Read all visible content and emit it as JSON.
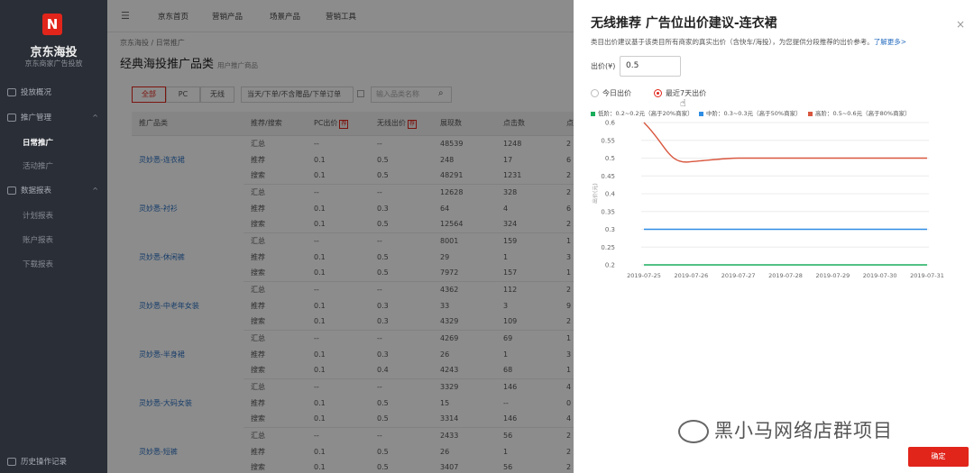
{
  "sidebar": {
    "logo_glyph": "N",
    "brand": "京东海投",
    "brand_sub": "京东商家广告投放",
    "items": [
      {
        "label": "投放概况",
        "type": "main",
        "icon": "monitor-icon"
      },
      {
        "label": "推广管理",
        "type": "main",
        "icon": "folder-icon",
        "chevron": "^"
      },
      {
        "label": "日常推广",
        "type": "sub",
        "active": true
      },
      {
        "label": "活动推广",
        "type": "sub"
      },
      {
        "label": "数据报表",
        "type": "main",
        "icon": "chart-icon",
        "chevron": "^"
      },
      {
        "label": "计划报表",
        "type": "sub"
      },
      {
        "label": "账户报表",
        "type": "sub"
      },
      {
        "label": "下载报表",
        "type": "sub"
      }
    ],
    "footer": "历史操作记录"
  },
  "topbar": {
    "menu_icon": "☰",
    "items": [
      "京东首页",
      "营销产品",
      "场景产品",
      "营销工具"
    ]
  },
  "main": {
    "breadcrumb": "京东海投 / 日常推广",
    "title": "经典海投推广品类",
    "title_sub": "用户推广商品",
    "tabs": [
      "全部",
      "PC",
      "无线"
    ],
    "filter_select": "当天/下单/不含赠品/下单订单",
    "search_placeholder": "输入品类名称",
    "columns": [
      "推广品类",
      "推荐/搜索",
      "PC出价",
      "无线出价",
      "展现数",
      "点击数",
      "点"
    ],
    "tag": "荐",
    "rows": [
      {
        "product": "灵妙悉-连衣裙",
        "lines": [
          [
            "汇总",
            "--",
            "--",
            "48539",
            "1248",
            "2"
          ],
          [
            "推荐",
            "0.1",
            "0.5",
            "248",
            "17",
            "6"
          ],
          [
            "搜索",
            "0.1",
            "0.5",
            "48291",
            "1231",
            "2"
          ]
        ]
      },
      {
        "product": "灵妙悉-衬衫",
        "lines": [
          [
            "汇总",
            "--",
            "--",
            "12628",
            "328",
            "2"
          ],
          [
            "推荐",
            "0.1",
            "0.3",
            "64",
            "4",
            "6"
          ],
          [
            "搜索",
            "0.1",
            "0.5",
            "12564",
            "324",
            "2"
          ]
        ]
      },
      {
        "product": "灵妙悉-休闲裤",
        "lines": [
          [
            "汇总",
            "--",
            "--",
            "8001",
            "159",
            "1"
          ],
          [
            "推荐",
            "0.1",
            "0.5",
            "29",
            "1",
            "3"
          ],
          [
            "搜索",
            "0.1",
            "0.5",
            "7972",
            "157",
            "1"
          ]
        ]
      },
      {
        "product": "灵妙悉-中老年女装",
        "lines": [
          [
            "汇总",
            "--",
            "--",
            "4362",
            "112",
            "2"
          ],
          [
            "推荐",
            "0.1",
            "0.3",
            "33",
            "3",
            "9"
          ],
          [
            "搜索",
            "0.1",
            "0.3",
            "4329",
            "109",
            "2"
          ]
        ]
      },
      {
        "product": "灵妙悉-半身裙",
        "lines": [
          [
            "汇总",
            "--",
            "--",
            "4269",
            "69",
            "1"
          ],
          [
            "推荐",
            "0.1",
            "0.3",
            "26",
            "1",
            "3"
          ],
          [
            "搜索",
            "0.1",
            "0.4",
            "4243",
            "68",
            "1"
          ]
        ]
      },
      {
        "product": "灵妙悉-大码女装",
        "lines": [
          [
            "汇总",
            "--",
            "--",
            "3329",
            "146",
            "4"
          ],
          [
            "推荐",
            "0.1",
            "0.5",
            "15",
            "--",
            "0"
          ],
          [
            "搜索",
            "0.1",
            "0.5",
            "3314",
            "146",
            "4"
          ]
        ]
      },
      {
        "product": "灵妙悉-短裤",
        "lines": [
          [
            "汇总",
            "--",
            "--",
            "2433",
            "56",
            "2"
          ],
          [
            "推荐",
            "0.1",
            "0.5",
            "26",
            "1",
            "2"
          ],
          [
            "搜索",
            "0.1",
            "0.5",
            "3407",
            "56",
            "2"
          ]
        ]
      }
    ]
  },
  "drawer": {
    "title": "无线推荐 广告位出价建议-连衣裙",
    "close": "×",
    "desc": "类目出价建议基于该类目所有商家的真实出价（含快车/海投），为您提供分段推荐的出价参考。",
    "desc_link": "了解更多>",
    "price_label": "出价(¥)",
    "price_value": "0.5",
    "radio_today": "今日出价",
    "radio_7days": "最近7天出价",
    "ok_label": "确定"
  },
  "chart_data": {
    "type": "line",
    "x": [
      "2019-07-25",
      "2019-07-26",
      "2019-07-27",
      "2019-07-28",
      "2019-07-29",
      "2019-07-30",
      "2019-07-31"
    ],
    "ylabel": "出价(元)",
    "ylim": [
      0.2,
      0.6
    ],
    "yticks": [
      "0.6",
      "0.55",
      "0.5",
      "0.45",
      "0.4",
      "0.35",
      "0.3",
      "0.25",
      "0.2"
    ],
    "grid": true,
    "legend_position": "top-left",
    "series": [
      {
        "name": "低阶：0.2~0.2元（高于20%商家）",
        "color": "#1aad5c",
        "values": [
          0.2,
          0.2,
          0.2,
          0.2,
          0.2,
          0.2,
          0.2
        ]
      },
      {
        "name": "中阶：0.3~0.3元（高于50%商家）",
        "color": "#2f8de4",
        "values": [
          0.3,
          0.3,
          0.3,
          0.3,
          0.3,
          0.3,
          0.3
        ]
      },
      {
        "name": "高阶：0.5~0.6元（高于80%商家）",
        "color": "#d9573f",
        "values": [
          0.6,
          0.49,
          0.5,
          0.5,
          0.5,
          0.5,
          0.5
        ]
      }
    ]
  },
  "watermark": "黑小马网络店群项目"
}
